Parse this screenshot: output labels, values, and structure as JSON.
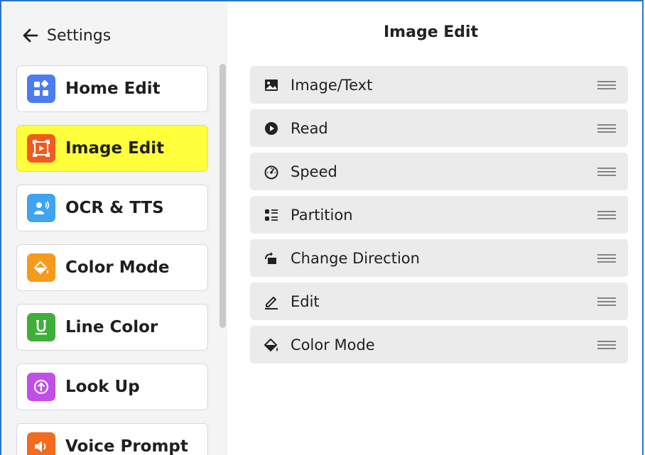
{
  "header": {
    "back_label": "Settings",
    "panel_title": "Image Edit"
  },
  "sidebar": {
    "items": [
      {
        "label": "Home Edit",
        "icon": "grid-icon",
        "color": "#4c7cf0"
      },
      {
        "label": "Image Edit",
        "icon": "image-frame-icon",
        "color": "#f25a1e",
        "active": true
      },
      {
        "label": "OCR & TTS",
        "icon": "ocr-tts-icon",
        "color": "#3fa4f0"
      },
      {
        "label": "Color Mode",
        "icon": "paint-bucket-icon",
        "color": "#f59a1b"
      },
      {
        "label": "Line Color",
        "icon": "underline-icon",
        "color": "#3fae3a"
      },
      {
        "label": "Look Up",
        "icon": "arrow-up-circle-icon",
        "color": "#c04ee8"
      },
      {
        "label": "Voice Prompt",
        "icon": "speaker-icon",
        "color": "#f26b1e"
      }
    ]
  },
  "toolbar_items": [
    {
      "label": "Image/Text",
      "icon": "image-icon"
    },
    {
      "label": "Read",
      "icon": "play-circle-icon"
    },
    {
      "label": "Speed",
      "icon": "speedometer-icon"
    },
    {
      "label": "Partition",
      "icon": "list-partition-icon"
    },
    {
      "label": "Change Direction",
      "icon": "rotate-icon"
    },
    {
      "label": "Edit",
      "icon": "pencil-icon"
    },
    {
      "label": "Color Mode",
      "icon": "paint-bucket-icon"
    }
  ],
  "colors": {
    "active_highlight": "#ffff3c",
    "window_border": "#2f74c9",
    "row_bg": "#ebebeb"
  }
}
